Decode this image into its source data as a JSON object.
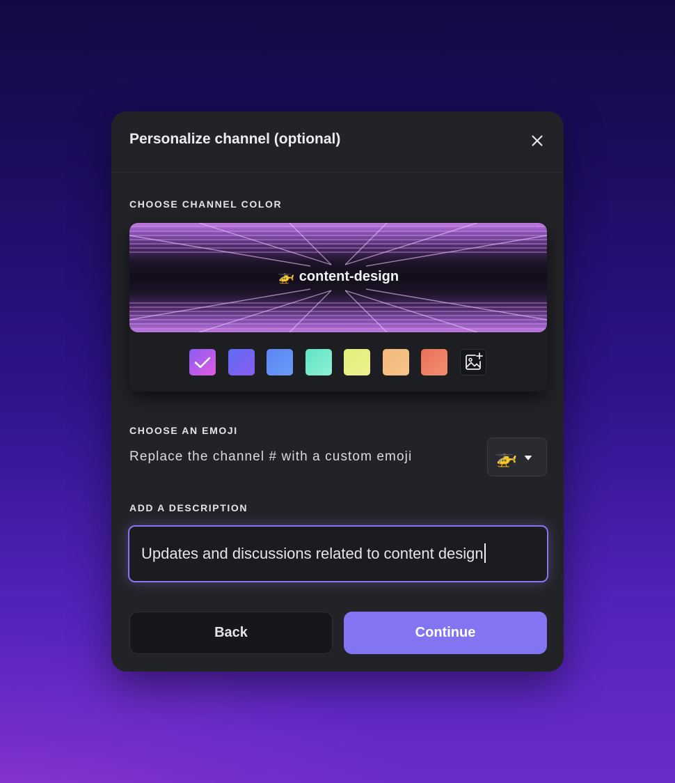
{
  "modal": {
    "title": "Personalize channel (optional)",
    "close_icon": "close-icon"
  },
  "color_section": {
    "label": "CHOOSE CHANNEL COLOR",
    "preview": {
      "emoji": "🚁",
      "channel_name": "content-design"
    },
    "swatches": [
      {
        "name": "purple-pink",
        "from": "#8a5cf5",
        "to": "#e25be0",
        "selected": true
      },
      {
        "name": "indigo",
        "from": "#5f6cf4",
        "to": "#8a5df0",
        "selected": false
      },
      {
        "name": "blue",
        "from": "#5a84f5",
        "to": "#6a9cf5",
        "selected": false
      },
      {
        "name": "mint",
        "from": "#5fe3c5",
        "to": "#8ff0d6",
        "selected": false
      },
      {
        "name": "yellow",
        "from": "#e0f07a",
        "to": "#f0ef8f",
        "selected": false
      },
      {
        "name": "orange",
        "from": "#f2b97a",
        "to": "#f7c48a",
        "selected": false
      },
      {
        "name": "coral",
        "from": "#ea6e5b",
        "to": "#f29071",
        "selected": false
      }
    ],
    "upload_icon": "image-add-icon"
  },
  "emoji_section": {
    "label": "CHOOSE AN EMOJI",
    "description": "Replace the channel # with a custom emoji",
    "selected_emoji": "🚁",
    "dropdown_icon": "caret-down-icon"
  },
  "description_section": {
    "label": "ADD A DESCRIPTION",
    "value": "Updates and discussions related to content design"
  },
  "actions": {
    "back_label": "Back",
    "continue_label": "Continue"
  },
  "colors": {
    "accent": "#8374f2",
    "modal_bg": "#222327",
    "input_border": "#8b74f0"
  }
}
